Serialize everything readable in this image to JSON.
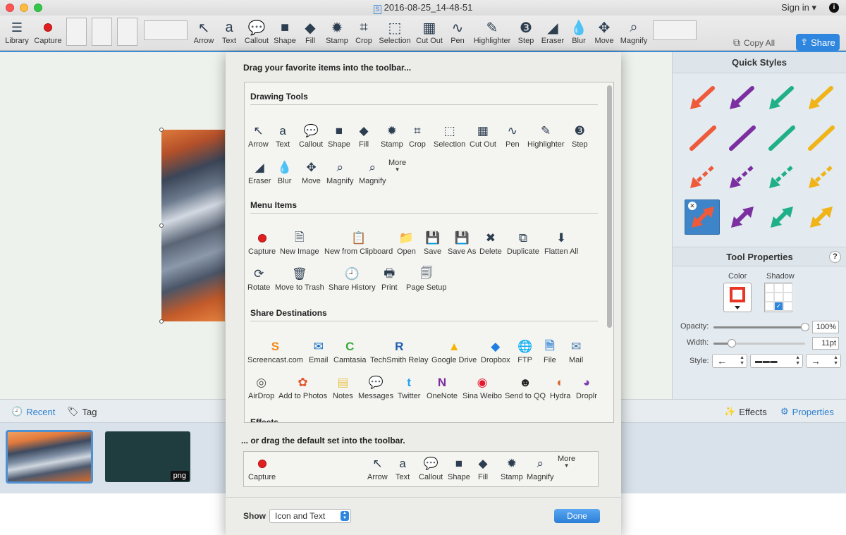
{
  "window": {
    "title": "2016-08-25_14-48-51",
    "sign_in": "Sign in ▾"
  },
  "toolbar": {
    "left_items": [
      {
        "name": "library",
        "label": "Library",
        "icon": "hamburger-icon"
      },
      {
        "name": "capture",
        "label": "Capture",
        "icon": "record-icon"
      }
    ],
    "tools": [
      {
        "name": "arrow",
        "label": "Arrow",
        "glyph": "↖"
      },
      {
        "name": "text",
        "label": "Text",
        "glyph": "a"
      },
      {
        "name": "callout",
        "label": "Callout",
        "glyph": "💬"
      },
      {
        "name": "shape",
        "label": "Shape",
        "glyph": "■"
      },
      {
        "name": "fill",
        "label": "Fill",
        "glyph": "◆"
      },
      {
        "name": "stamp",
        "label": "Stamp",
        "glyph": "✹"
      },
      {
        "name": "crop",
        "label": "Crop",
        "glyph": "⌗"
      },
      {
        "name": "selection",
        "label": "Selection",
        "glyph": "⬚"
      },
      {
        "name": "cut-out",
        "label": "Cut Out",
        "glyph": "▦"
      },
      {
        "name": "pen",
        "label": "Pen",
        "glyph": "∿"
      },
      {
        "name": "highlighter",
        "label": "Highlighter",
        "glyph": "✎"
      },
      {
        "name": "step",
        "label": "Step",
        "glyph": "❸"
      },
      {
        "name": "eraser",
        "label": "Eraser",
        "glyph": "◢"
      },
      {
        "name": "blur",
        "label": "Blur",
        "glyph": "💧"
      },
      {
        "name": "move",
        "label": "Move",
        "glyph": "✥"
      },
      {
        "name": "magnify",
        "label": "Magnify",
        "glyph": "⌕"
      }
    ],
    "copy_all": "Copy All",
    "share": "Share"
  },
  "quick_styles": {
    "title": "Quick Styles",
    "colors": [
      "#ee5a3a",
      "#7b2fa0",
      "#1fb08a",
      "#f0b418"
    ]
  },
  "tool_properties": {
    "title": "Tool Properties",
    "help": "?",
    "color_label": "Color",
    "shadow_label": "Shadow",
    "opacity_label": "Opacity:",
    "opacity_value": "100%",
    "opacity_fraction": 1.0,
    "width_label": "Width:",
    "width_value": "11pt",
    "width_fraction": 0.2,
    "style_label": "Style:",
    "style_start": "←",
    "style_line": "▬ ▬ ▬",
    "style_end": "→",
    "accent_color": "#e83524"
  },
  "bottom_bar": {
    "recent": "Recent",
    "tag": "Tag",
    "effects": "Effects",
    "properties": "Properties"
  },
  "thumbnails": {
    "badge": "png"
  },
  "sheet": {
    "title": "Drag your favorite items into the toolbar...",
    "drawing_tools_title": "Drawing Tools",
    "drawing_tools_row1": [
      {
        "label": "Arrow",
        "glyph": "↖"
      },
      {
        "label": "Text",
        "glyph": "a"
      },
      {
        "label": "Callout",
        "glyph": "💬"
      },
      {
        "label": "Shape",
        "glyph": "■"
      },
      {
        "label": "Fill",
        "glyph": "◆"
      },
      {
        "label": "Stamp",
        "glyph": "✹"
      },
      {
        "label": "Crop",
        "glyph": "⌗"
      },
      {
        "label": "Selection",
        "glyph": "⬚"
      },
      {
        "label": "Cut Out",
        "glyph": "▦"
      },
      {
        "label": "Pen",
        "glyph": "∿"
      },
      {
        "label": "Highlighter",
        "glyph": "✎"
      },
      {
        "label": "Step",
        "glyph": "❸"
      }
    ],
    "drawing_tools_row2": [
      {
        "label": "Eraser",
        "glyph": "◢"
      },
      {
        "label": "Blur",
        "glyph": "💧"
      },
      {
        "label": "Move",
        "glyph": "✥"
      },
      {
        "label": "Magnify",
        "glyph": "⌕"
      },
      {
        "label": "Magnify",
        "glyph": "⌕"
      },
      {
        "label": "More",
        "glyph": ""
      }
    ],
    "menu_items_title": "Menu Items",
    "menu_items_row1": [
      {
        "label": "Capture",
        "glyph": "●"
      },
      {
        "label": "New Image",
        "glyph": "🗎"
      },
      {
        "label": "New from Clipboard",
        "glyph": "📋"
      },
      {
        "label": "Open",
        "glyph": "📁"
      },
      {
        "label": "Save",
        "glyph": "💾"
      },
      {
        "label": "Save As",
        "glyph": "💾"
      },
      {
        "label": "Delete",
        "glyph": "✖"
      },
      {
        "label": "Duplicate",
        "glyph": "⧉"
      },
      {
        "label": "Flatten All",
        "glyph": "⬇"
      }
    ],
    "menu_items_row2": [
      {
        "label": "Rotate",
        "glyph": "⟳"
      },
      {
        "label": "Move to Trash",
        "glyph": "🗑"
      },
      {
        "label": "Share History",
        "glyph": "🕘"
      },
      {
        "label": "Print",
        "glyph": "🖶"
      },
      {
        "label": "Page Setup",
        "glyph": "🗐"
      }
    ],
    "share_title": "Share Destinations",
    "share_row1": [
      {
        "label": "Screencast.com",
        "glyph": "S",
        "color": "#f28a1a"
      },
      {
        "label": "Email",
        "glyph": "✉",
        "color": "#0f6bc2"
      },
      {
        "label": "Camtasia",
        "glyph": "C",
        "color": "#3daa3d"
      },
      {
        "label": "TechSmith Relay",
        "glyph": "R",
        "color": "#1f5fae"
      },
      {
        "label": "Google Drive",
        "glyph": "▲",
        "color": "#f4b400"
      },
      {
        "label": "Dropbox",
        "glyph": "◆",
        "color": "#1e7fe0"
      },
      {
        "label": "FTP",
        "glyph": "🌐",
        "color": "#2b6bc9"
      },
      {
        "label": "File",
        "glyph": "🗎",
        "color": "#4a90d9"
      },
      {
        "label": "Mail",
        "glyph": "✉",
        "color": "#4a7ab0"
      }
    ],
    "share_row2": [
      {
        "label": "AirDrop",
        "glyph": "◎",
        "color": "#555"
      },
      {
        "label": "Add to Photos",
        "glyph": "✿",
        "color": "#e4572e"
      },
      {
        "label": "Notes",
        "glyph": "▤",
        "color": "#e8c44a"
      },
      {
        "label": "Messages",
        "glyph": "💬",
        "color": "#1e90ff"
      },
      {
        "label": "Twitter",
        "glyph": "t",
        "color": "#1da1f2"
      },
      {
        "label": "OneNote",
        "glyph": "N",
        "color": "#7b2f9e"
      },
      {
        "label": "Sina Weibo",
        "glyph": "◉",
        "color": "#e6162d"
      },
      {
        "label": "Send to QQ",
        "glyph": "☻",
        "color": "#222"
      },
      {
        "label": "Hydra",
        "glyph": "◐",
        "color": "#d4662a"
      },
      {
        "label": "Droplr",
        "glyph": "◕",
        "color": "#7a3fb0"
      }
    ],
    "effects_title": "Effects",
    "default_title": "... or drag the default set into the toolbar.",
    "default_set": [
      {
        "label": "Capture",
        "glyph": "●"
      },
      {
        "label": "Arrow",
        "glyph": "↖"
      },
      {
        "label": "Text",
        "glyph": "a"
      },
      {
        "label": "Callout",
        "glyph": "💬"
      },
      {
        "label": "Shape",
        "glyph": "■"
      },
      {
        "label": "Fill",
        "glyph": "◆"
      },
      {
        "label": "Stamp",
        "glyph": "✹"
      },
      {
        "label": "Magnify",
        "glyph": "⌕"
      },
      {
        "label": "More",
        "glyph": ""
      }
    ],
    "show_label": "Show",
    "show_value": "Icon and Text",
    "done": "Done"
  }
}
